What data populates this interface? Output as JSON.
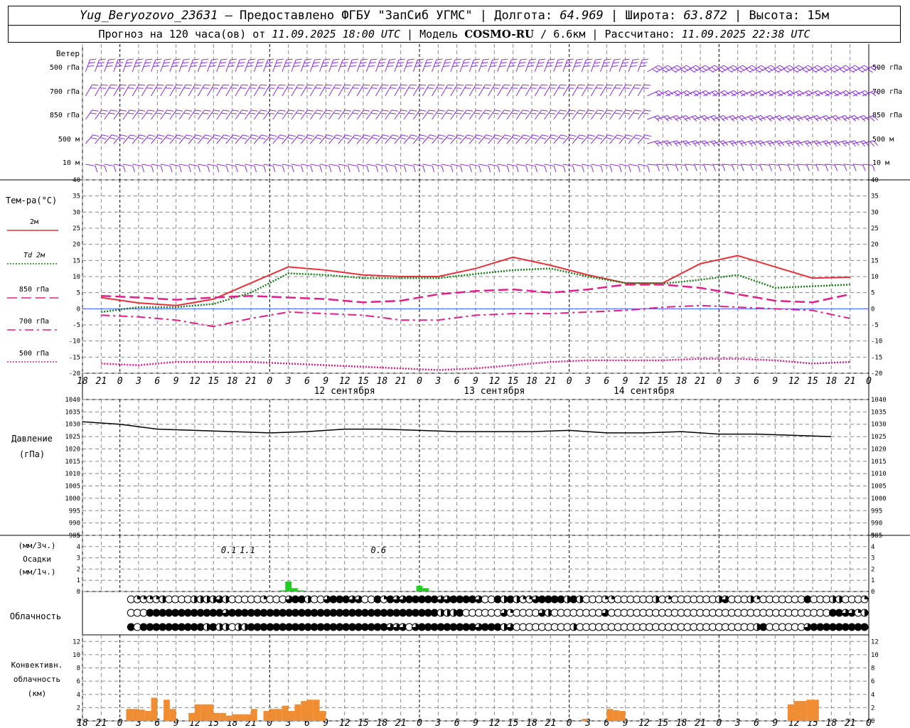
{
  "header": {
    "station": "Yug_Beryozovo_23631",
    "provided_by": " – Предоставлено ФГБУ \"ЗапСиб УГМС\" | Долгота: ",
    "longitude": "64.969",
    "lat_label": " | Широта: ",
    "latitude": "63.872",
    "alt_label": " | Высота: ",
    "altitude": "15м",
    "forecast_label": "Прогноз на 120 часа(ов) от ",
    "forecast_start": "11.09.2025 18:00 UTC",
    "model_label": " | Модель ",
    "model": "COSMO-RU",
    "resolution": " / 6.6км",
    "calc_label": " | Рассчитано: ",
    "calculated": "11.09.2025 22:38 UTC"
  },
  "chart_data": [
    {
      "type": "wind_barbs",
      "title": "Ветер",
      "levels": [
        "500 гПа",
        "700 гПа",
        "850 гПа",
        "500 м",
        "10 м"
      ],
      "color": "#8a2be2"
    },
    {
      "type": "line",
      "title": "Тем-ра(°С)",
      "ylim": [
        -20,
        40
      ],
      "yticks": [
        40,
        35,
        30,
        25,
        20,
        15,
        10,
        5,
        0,
        -5,
        -10,
        -15,
        -20
      ],
      "x": [
        0,
        6,
        12,
        18,
        24,
        30,
        36,
        42,
        48,
        54,
        60,
        66,
        72,
        78,
        84,
        90,
        96,
        102,
        108,
        114,
        120
      ],
      "series": [
        {
          "name": "2м",
          "label_prefix": "",
          "color": "#e8303a",
          "style": "solid",
          "values": [
            3.5,
            1.8,
            1.0,
            3.0,
            8.0,
            13.0,
            12.0,
            10.5,
            10.0,
            10.0,
            12.5,
            16.0,
            13.5,
            10.5,
            8.0,
            8.0,
            14.0,
            16.5,
            13.0,
            9.5,
            9.8
          ]
        },
        {
          "name": "2м",
          "label_prefix": "Td",
          "color": "#1a7f1a",
          "style": "dotted",
          "values": [
            -1.0,
            0.5,
            0.5,
            1.5,
            5.0,
            11.0,
            10.5,
            9.5,
            9.5,
            9.5,
            10.8,
            12.0,
            12.5,
            10.0,
            8.0,
            7.8,
            9.0,
            10.5,
            6.5,
            7.0,
            7.5
          ]
        },
        {
          "name": "850 гПа",
          "label_prefix": "",
          "color": "#e0208a",
          "style": "dash",
          "values": [
            4.0,
            3.5,
            2.8,
            3.5,
            4.0,
            3.5,
            3.0,
            2.0,
            2.5,
            4.5,
            5.5,
            6.0,
            5.0,
            6.0,
            7.5,
            7.5,
            6.5,
            4.5,
            2.5,
            2.0,
            4.5
          ]
        },
        {
          "name": "700 гПа",
          "label_prefix": "",
          "color": "#e0208a",
          "style": "dashdot",
          "values": [
            -2.0,
            -2.5,
            -3.5,
            -5.5,
            -3.0,
            -1.0,
            -1.5,
            -2.0,
            -3.5,
            -3.5,
            -2.0,
            -1.5,
            -1.5,
            -1.0,
            -0.5,
            0.5,
            1.0,
            0.5,
            0.0,
            -0.5,
            -3.0
          ]
        },
        {
          "name": "500 гПа",
          "label_prefix": "",
          "color": "#e0208a",
          "style": "dotted",
          "values": [
            -17.0,
            -17.5,
            -16.5,
            -16.5,
            -16.5,
            -17.0,
            -17.5,
            -18.0,
            -18.5,
            -19.0,
            -18.5,
            -17.5,
            -16.5,
            -16.0,
            -16.0,
            -16.0,
            -15.5,
            -15.5,
            -16.0,
            -17.0,
            -16.5
          ]
        }
      ]
    },
    {
      "type": "line",
      "title": "Давление",
      "unit": "(гПа)",
      "ylim": [
        985,
        1040
      ],
      "yticks": [
        1040,
        1035,
        1030,
        1025,
        1020,
        1015,
        1010,
        1005,
        1000,
        995,
        990,
        985
      ],
      "x": [
        0,
        6,
        12,
        18,
        24,
        30,
        36,
        42,
        48,
        54,
        60,
        66,
        72,
        78,
        84,
        90,
        96,
        102,
        108,
        114,
        120
      ],
      "values": [
        1031.0,
        1030.0,
        1028.0,
        1027.5,
        1027.0,
        1026.5,
        1027.0,
        1028.0,
        1028.0,
        1027.5,
        1027.0,
        1027.0,
        1027.0,
        1027.5,
        1026.5,
        1026.5,
        1027.0,
        1026.0,
        1026.0,
        1025.5,
        1025.0
      ],
      "color": "#000000"
    },
    {
      "type": "bar",
      "title": "Осадки",
      "units": [
        "(мм/3ч.)",
        "(мм/1ч.)"
      ],
      "ylim": [
        0,
        5
      ],
      "yticks": [
        5,
        4,
        3,
        2,
        1,
        0
      ],
      "annotations": [
        {
          "x": 24,
          "text": "0.1"
        },
        {
          "x": 27,
          "text": "1.1"
        },
        {
          "x": 48,
          "text": "0.6"
        }
      ],
      "x": [
        26,
        27,
        28,
        29,
        48,
        49,
        50
      ],
      "values": [
        0.1,
        0.9,
        0.3,
        0.1,
        0.5,
        0.3,
        0.05
      ],
      "color": "#22cc22"
    },
    {
      "type": "cloud_cover",
      "title": "Облачность",
      "rows": [
        "0000000022224000044446400000200068840068886600828668888866888860084842268888484000220000004020000000460004200000008000440002",
        "0000000000888888888888688888888888888888888888888888888844480000006200006400000000600000000000000000000000000000000000886624",
        "0000000808888888888484404488888888888888888888886660688888888868884600000000040000000000000000000000000000480000006888888888"
      ]
    },
    {
      "type": "bar",
      "title": "Конвективн.",
      "unit_lines": [
        "облачность",
        "(км)"
      ],
      "ylim": [
        0,
        13
      ],
      "yticks": [
        12,
        10,
        8,
        6,
        4,
        2,
        0
      ],
      "x": [
        7,
        8,
        9,
        10,
        11,
        12,
        13,
        14,
        16,
        17,
        18,
        19,
        20,
        21,
        22,
        23,
        24,
        25,
        26,
        27,
        28,
        29,
        30,
        31,
        32,
        33,
        34,
        35,
        36,
        37,
        38,
        39,
        40,
        41,
        42,
        43,
        44,
        45,
        46,
        47,
        48,
        49,
        50,
        51,
        52,
        53,
        54,
        55,
        56,
        57,
        58,
        80,
        84,
        85,
        86,
        87,
        88,
        113,
        114,
        115,
        116,
        117
      ],
      "values": [
        1.8,
        1.8,
        1.7,
        1.5,
        3.5,
        0,
        3.2,
        1.8,
        0,
        1.2,
        2.5,
        2.5,
        2.5,
        1.2,
        1.2,
        0.8,
        1.0,
        1.0,
        1.0,
        1.8,
        0,
        1.5,
        1.8,
        1.8,
        2.3,
        1.5,
        2.5,
        3.0,
        3.2,
        3.2,
        1.5,
        0,
        0,
        0,
        0,
        0,
        0,
        0,
        0,
        0,
        0,
        0,
        0,
        0,
        0,
        0,
        0,
        0,
        0,
        0,
        0,
        0.3,
        1.8,
        1.6,
        1.5,
        0,
        0,
        2.5,
        3.0,
        3.0,
        3.2,
        3.2
      ],
      "color": "#f08c32"
    }
  ],
  "axis": {
    "hour_labels": [
      "18",
      "21",
      "0",
      "3",
      "6",
      "9",
      "12",
      "15",
      "18",
      "21",
      "0",
      "3",
      "6",
      "9",
      "12",
      "15",
      "18",
      "21",
      "0",
      "3",
      "6",
      "9",
      "12",
      "15",
      "18",
      "21",
      "0",
      "3",
      "6",
      "9",
      "12",
      "15",
      "18",
      "21",
      "0",
      "3",
      "6",
      "9",
      "12",
      "15",
      "18",
      "21",
      "0"
    ],
    "dates": [
      {
        "x": 42,
        "text": "12 сентября"
      },
      {
        "x": 66,
        "text": "13 сентября"
      },
      {
        "x": 90,
        "text": "14 сентября"
      }
    ]
  }
}
